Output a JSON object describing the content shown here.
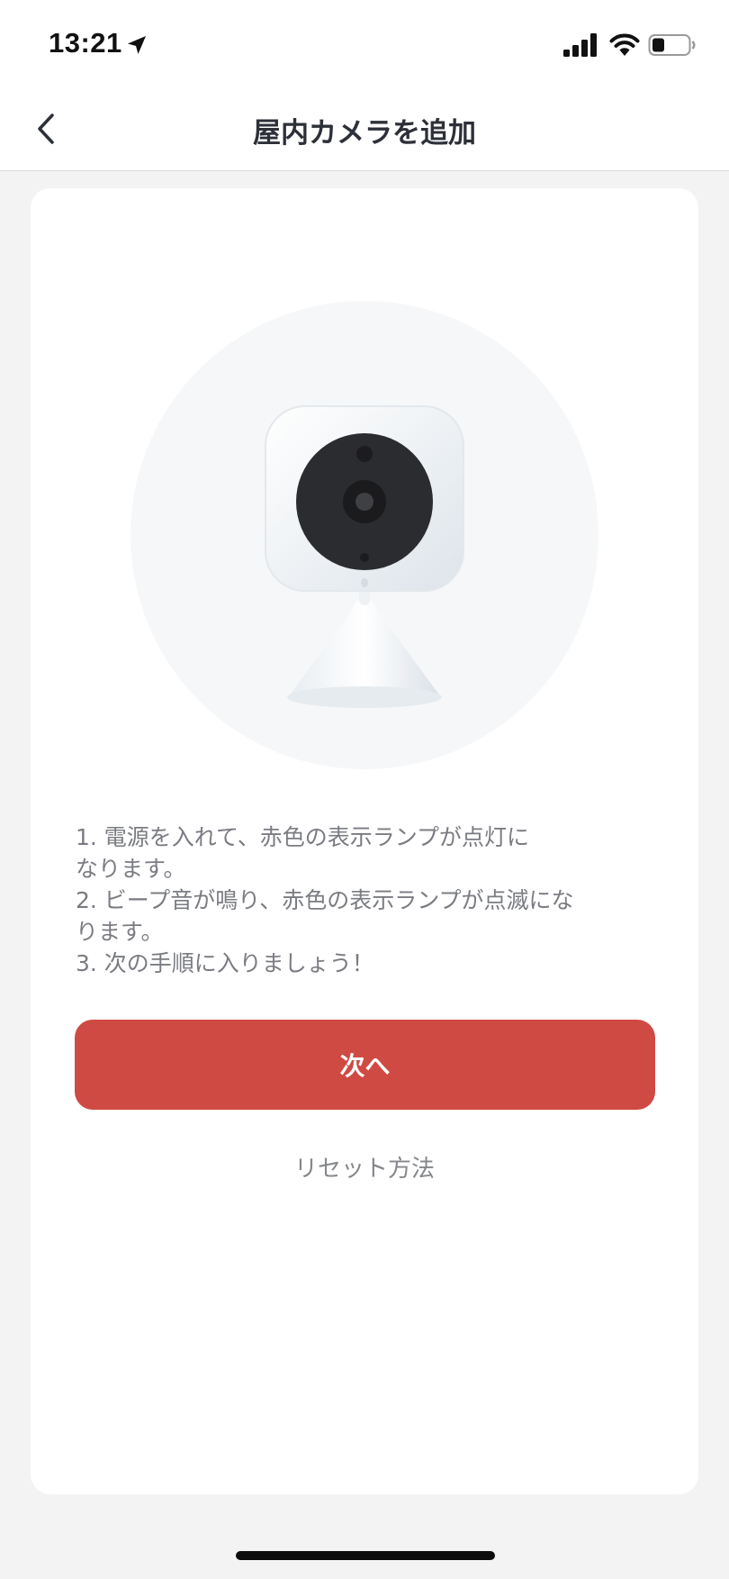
{
  "status_bar": {
    "time": "13:21",
    "icons": [
      "location-arrow-icon",
      "cellular-signal-icon",
      "wifi-icon",
      "battery-icon"
    ]
  },
  "nav": {
    "back_icon": "chevron-left-icon",
    "title": "屋内カメラを追加"
  },
  "illustration": {
    "icon": "indoor-camera-illustration"
  },
  "instructions": [
    "1.   電源を入れて、赤色の表示ランプが点灯に",
    "なります。",
    "2.   ビープ音が鳴り、赤色の表示ランプが点滅にな",
    "ります。",
    "3.   次の手順に入りましょう！"
  ],
  "actions": {
    "next_label": "次へ",
    "reset_label": "リセット方法"
  },
  "colors": {
    "accent": "#cf4a43",
    "background": "#f3f3f3",
    "card": "#ffffff",
    "title_text": "#2d3038",
    "body_text": "#7a7c82"
  }
}
